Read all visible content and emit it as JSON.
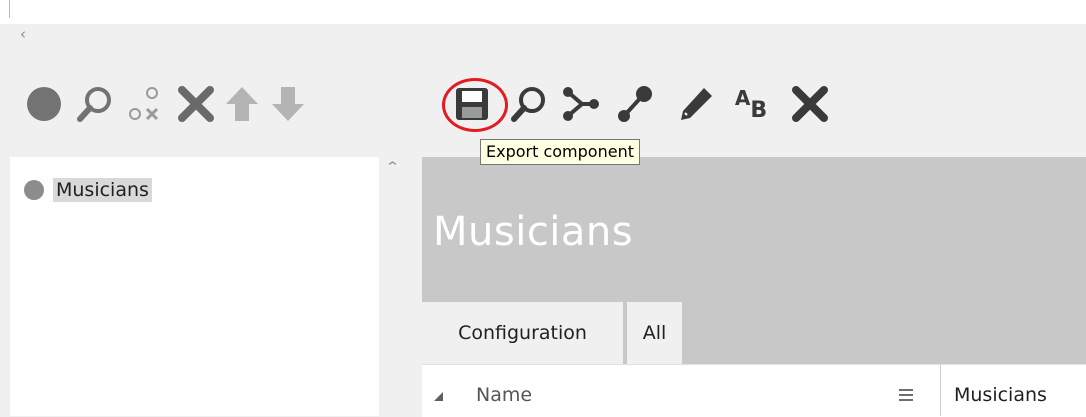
{
  "left_toolbar": {
    "icons": [
      "circle-add-icon",
      "search-icon",
      "nodes-remove-icon",
      "delete-icon",
      "arrow-up-icon",
      "arrow-down-icon"
    ]
  },
  "right_toolbar": {
    "icons": [
      "save-icon",
      "search-icon",
      "branch-icon",
      "link-icon",
      "pencil-icon",
      "rename-icon",
      "delete-icon"
    ],
    "rename_glyph": "A",
    "rename_sub_glyph": "B"
  },
  "tooltip": {
    "text": "Export component"
  },
  "tree": {
    "items": [
      {
        "label": "Musicians"
      }
    ]
  },
  "component": {
    "title": "Musicians"
  },
  "tabs": [
    {
      "label": "Configuration"
    },
    {
      "label": "All"
    }
  ],
  "grid": {
    "column_header": "Name",
    "value": "Musicians"
  },
  "colors": {
    "highlight_ring": "#e31b23",
    "header_band": "#c8c8c8",
    "icon_gray": "#808080",
    "icon_dark": "#3a3a3a",
    "selection": "#d9d9d9",
    "tooltip_bg": "#ffffe1"
  }
}
